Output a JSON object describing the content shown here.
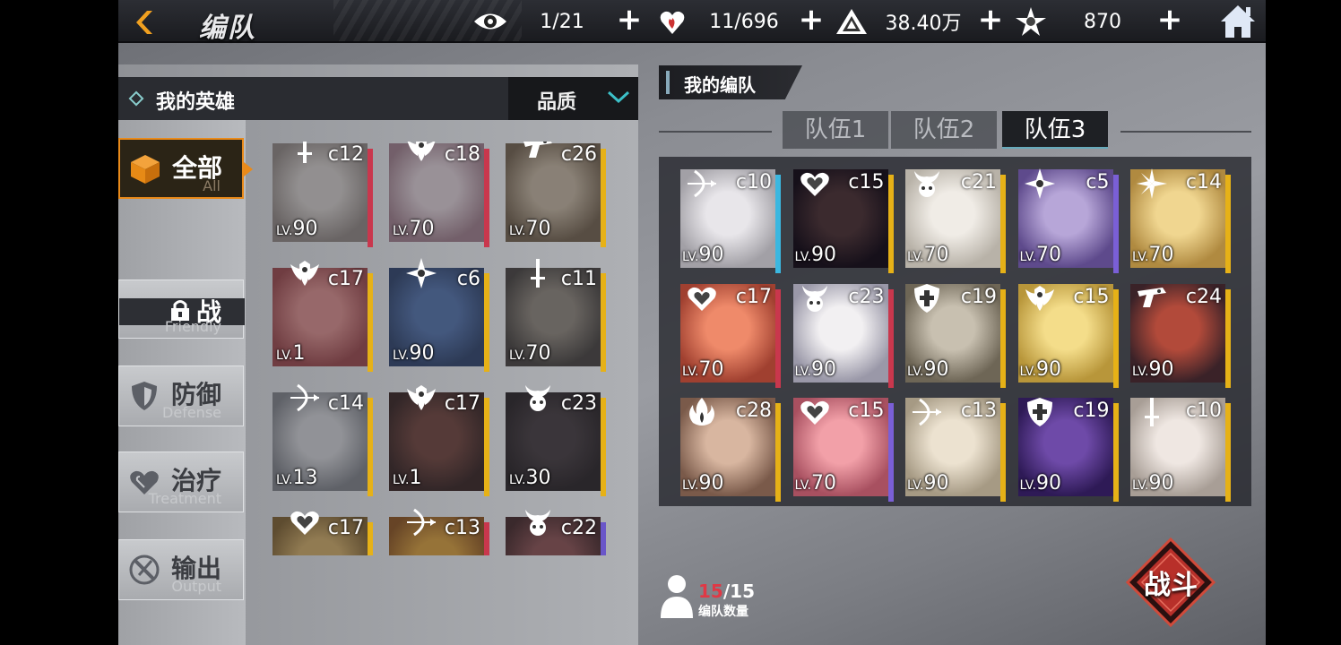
{
  "header": {
    "title": "编队",
    "resources": [
      {
        "icon": "eye-icon",
        "value": "1/21"
      },
      {
        "icon": "heart-fire-icon",
        "value": "11/696"
      },
      {
        "icon": "triangle-crest-icon",
        "value": "38.40万"
      },
      {
        "icon": "star-emblem-icon",
        "value": "870"
      }
    ]
  },
  "left_panel": {
    "title": "我的英雄",
    "filter_label": "品质",
    "categories": [
      {
        "name": "全部",
        "sub": "All"
      },
      {
        "name": "战",
        "sub": "Friendly"
      },
      {
        "name": "防御",
        "sub": "Defense"
      },
      {
        "name": "治疗",
        "sub": "Treatment"
      },
      {
        "name": "输出",
        "sub": "Output"
      }
    ],
    "heroes": [
      {
        "cost": "c12",
        "level": "90",
        "cls": "sword",
        "ribbon": "#c9374d"
      },
      {
        "cost": "c18",
        "level": "70",
        "cls": "shield-wing",
        "ribbon": "#c9374d"
      },
      {
        "cost": "c26",
        "level": "70",
        "cls": "gun",
        "ribbon": "#e6b117"
      },
      {
        "cost": "c17",
        "level": "1",
        "cls": "shield-wing",
        "ribbon": "#e6b117"
      },
      {
        "cost": "c6",
        "level": "90",
        "cls": "shuriken",
        "ribbon": "#e6b117"
      },
      {
        "cost": "c11",
        "level": "70",
        "cls": "sword",
        "ribbon": "#e6b117"
      },
      {
        "cost": "c14",
        "level": "13",
        "cls": "bow",
        "ribbon": "#e6b117"
      },
      {
        "cost": "c17",
        "level": "1",
        "cls": "shield-wing",
        "ribbon": "#e6b117"
      },
      {
        "cost": "c23",
        "level": "30",
        "cls": "demon",
        "ribbon": "#e6b117"
      },
      {
        "cost": "c17",
        "level": "",
        "cls": "heart",
        "ribbon": "#e6b117"
      },
      {
        "cost": "c13",
        "level": "",
        "cls": "bow",
        "ribbon": "#c9374d"
      },
      {
        "cost": "c22",
        "level": "",
        "cls": "demon",
        "ribbon": "#6a56c9"
      }
    ]
  },
  "right_panel": {
    "title": "我的编队",
    "tabs": [
      "队伍1",
      "队伍2",
      "队伍3"
    ],
    "active_tab": 2,
    "team": [
      {
        "cost": "c10",
        "level": "90",
        "cls": "bow",
        "ribbon": "#3bb7e0"
      },
      {
        "cost": "c15",
        "level": "90",
        "cls": "heart",
        "ribbon": "#e6b117"
      },
      {
        "cost": "c21",
        "level": "70",
        "cls": "demon",
        "ribbon": "#e6b117"
      },
      {
        "cost": "c5",
        "level": "70",
        "cls": "shuriken",
        "ribbon": "#7a5fd6"
      },
      {
        "cost": "c14",
        "level": "70",
        "cls": "star",
        "ribbon": "#e6b117"
      },
      {
        "cost": "c17",
        "level": "70",
        "cls": "heart",
        "ribbon": "#c9374d"
      },
      {
        "cost": "c23",
        "level": "90",
        "cls": "demon",
        "ribbon": "#c9374d"
      },
      {
        "cost": "c19",
        "level": "90",
        "cls": "shield",
        "ribbon": "#e6b117"
      },
      {
        "cost": "c15",
        "level": "90",
        "cls": "shield-wing",
        "ribbon": "#e6b117"
      },
      {
        "cost": "c24",
        "level": "90",
        "cls": "gun",
        "ribbon": "#e6b117"
      },
      {
        "cost": "c28",
        "level": "90",
        "cls": "flame",
        "ribbon": "#e6b117"
      },
      {
        "cost": "c15",
        "level": "70",
        "cls": "heart",
        "ribbon": "#7a5fd6"
      },
      {
        "cost": "c13",
        "level": "90",
        "cls": "bow",
        "ribbon": "#e6b117"
      },
      {
        "cost": "c19",
        "level": "90",
        "cls": "shield",
        "ribbon": "#e6b117"
      },
      {
        "cost": "c10",
        "level": "90",
        "cls": "sword",
        "ribbon": "#e6b117"
      }
    ],
    "team_count_current": "15",
    "team_count_max": "/15",
    "team_count_label": "编队数量",
    "battle_label": "战斗"
  },
  "lv_prefix": "LV.",
  "colors": {
    "accent": "#e98a1a",
    "red": "#c9374d",
    "gold": "#e6b117",
    "purple": "#7a5fd6",
    "blue": "#3bb7e0"
  }
}
